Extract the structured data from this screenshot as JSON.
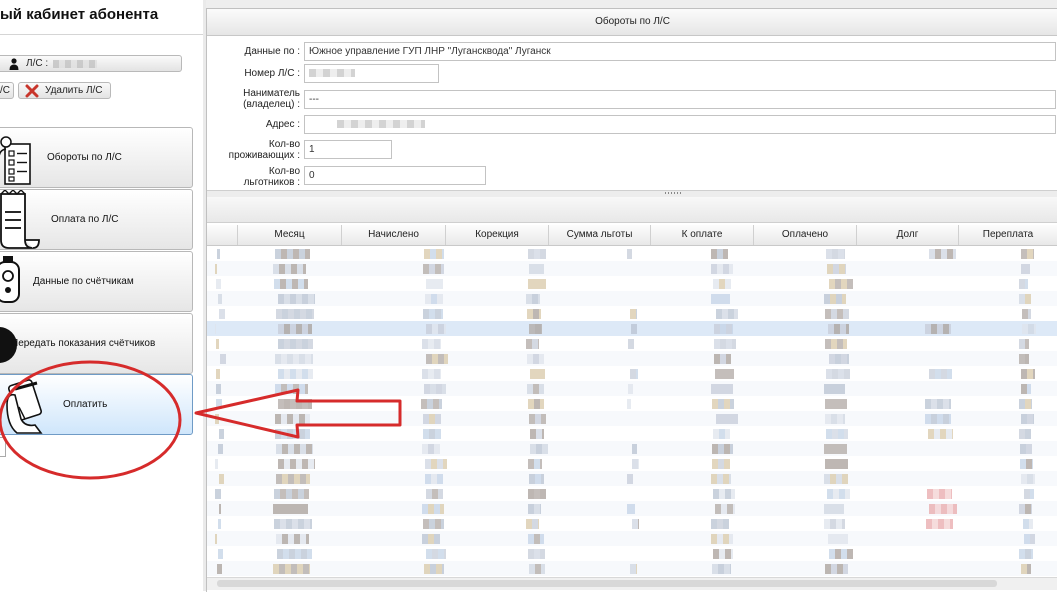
{
  "sidebar": {
    "title": "ый кабинет абонента",
    "account_label": "Л/С :",
    "btn_ls_label": "/С",
    "delete_label": "Удалить Л/С",
    "menu": [
      {
        "label": "Обороты по Л/С",
        "icon": "report-icon"
      },
      {
        "label": "Оплата по Л/С",
        "icon": "receipt-icon"
      },
      {
        "label": "Данные по счётчикам",
        "icon": "meter-icon"
      },
      {
        "label": "Передать показания счётчиков",
        "icon": "meter-send-icon"
      },
      {
        "label": "Оплатить",
        "icon": "card-payment-icon",
        "active": true
      }
    ]
  },
  "main": {
    "title": "Обороты по Л/С",
    "form": {
      "data_for_label": "Данные по :",
      "data_for_value": "Южное управление  ГУП ЛНР  \"Лугансквода\" Луганск",
      "account_number_label": "Номер Л/С :",
      "tenant_label_1": "Наниматель",
      "tenant_label_2": "(владелец) :",
      "tenant_value": "---",
      "address_label": "Адрес :",
      "residents_label_1": "Кол-во",
      "residents_label_2": "проживающих :",
      "residents_value": "1",
      "beneficiaries_label_1": "Кол-во",
      "beneficiaries_label_2": "льготников :",
      "beneficiaries_value": "0"
    },
    "grid_columns": [
      "Месяц",
      "Начислено",
      "Корекция",
      "Сумма льготы",
      "К оплате",
      "Оплачено",
      "Долг",
      "Переплата"
    ]
  },
  "colors": {
    "annotation": "#d62b2b",
    "active_menu": "#cfe6fb",
    "selected_row": "#dde9f7"
  }
}
